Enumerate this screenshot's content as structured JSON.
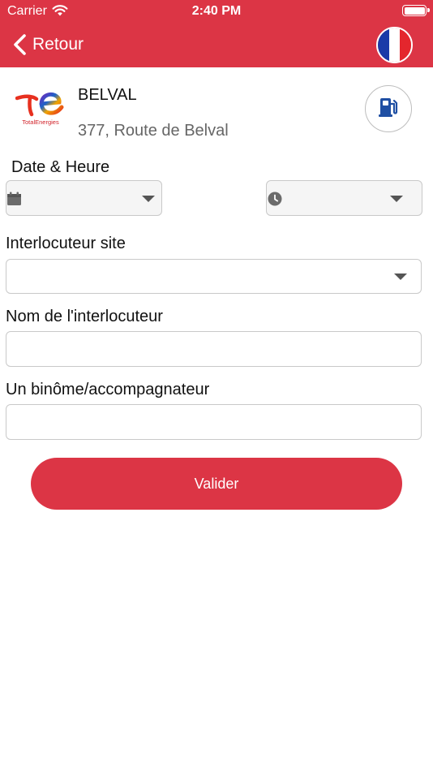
{
  "status_bar": {
    "carrier": "Carrier",
    "time": "2:40 PM",
    "icons": [
      "wifi-icon",
      "battery-icon"
    ]
  },
  "nav": {
    "back_label": "Retour",
    "back_icon": "chevron-left-icon",
    "language_icon": "france-flag-icon"
  },
  "station": {
    "logo_text": "TotalEnergies",
    "name": "BELVAL",
    "address": "377, Route de Belval",
    "action_icon": "fuel-pump-icon"
  },
  "form": {
    "date_heure_label": "Date & Heure",
    "date_value": "",
    "time_value": "",
    "date_icon": "calendar-icon",
    "time_icon": "clock-icon",
    "interlocuteur_site_label": "Interlocuteur site",
    "interlocuteur_site_value": "",
    "nom_interlocuteur_label": "Nom de l'interlocuteur",
    "nom_interlocuteur_value": "",
    "binome_label": "Un binôme/accompagnateur",
    "binome_value": "",
    "submit_label": "Valider"
  },
  "colors": {
    "primary": "#dc3545",
    "flag_blue": "#1a3aa8",
    "flag_red": "#e4262d",
    "fuel_icon_blue": "#1f4fa3"
  }
}
